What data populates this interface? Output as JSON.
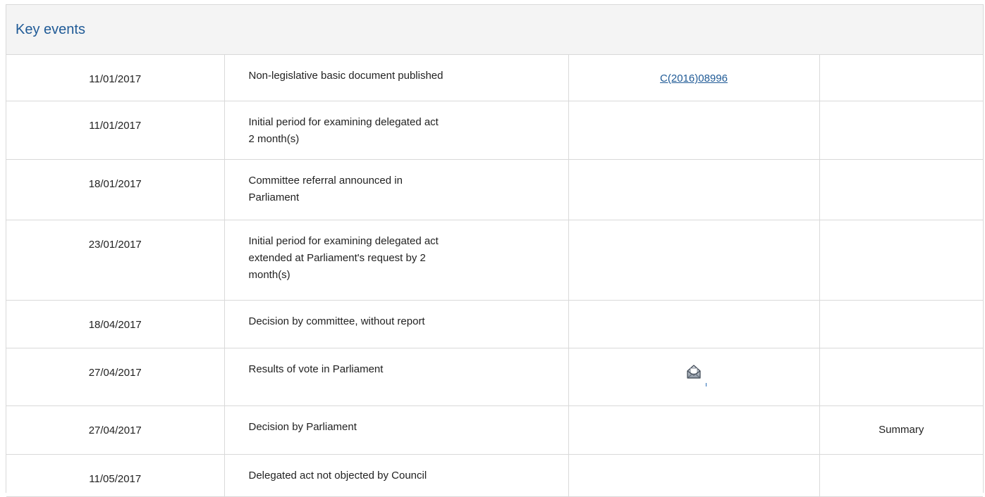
{
  "panel": {
    "title": "Key events"
  },
  "events": [
    {
      "date": "11/01/2017",
      "lines": [
        "Non-legislative basic document published"
      ],
      "doc": "C(2016)08996",
      "summary": ""
    },
    {
      "date": "11/01/2017",
      "lines": [
        "Initial period for examining delegated act",
        "2 month(s)"
      ],
      "doc": "",
      "summary": ""
    },
    {
      "date": "18/01/2017",
      "lines": [
        "Committee referral announced in",
        "Parliament"
      ],
      "doc": "",
      "summary": ""
    },
    {
      "date": "23/01/2017",
      "lines": [
        "Initial period for examining delegated act",
        "extended at Parliament's request by 2",
        "month(s)"
      ],
      "doc": "",
      "summary": ""
    },
    {
      "date": "18/04/2017",
      "lines": [
        "Decision by committee, without report"
      ],
      "doc": "",
      "summary": ""
    },
    {
      "date": "27/04/2017",
      "lines": [
        "Results of vote in Parliament"
      ],
      "doc_icon": "results-envelope-icon",
      "summary": ""
    },
    {
      "date": "27/04/2017",
      "lines": [
        "Decision by Parliament"
      ],
      "doc": "",
      "summary": "Summary"
    },
    {
      "date": "11/05/2017",
      "lines": [
        "Delegated act not objected by Council"
      ],
      "doc": "",
      "summary": ""
    }
  ]
}
